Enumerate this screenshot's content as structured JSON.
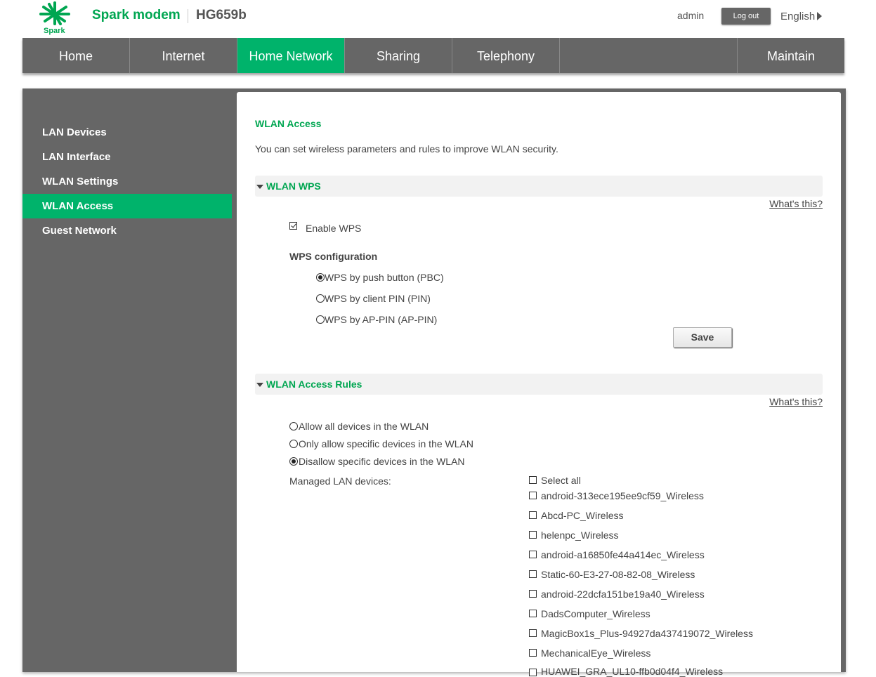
{
  "header": {
    "logo_text": "Spark",
    "brand": "Spark modem",
    "model": "HG659b",
    "user": "admin",
    "logout": "Log out",
    "language": "English"
  },
  "nav": [
    "Home",
    "Internet",
    "Home Network",
    "Sharing",
    "Telephony",
    "",
    "Maintain"
  ],
  "sidebar": [
    "LAN Devices",
    "LAN Interface",
    "WLAN Settings",
    "WLAN Access",
    "Guest Network"
  ],
  "content": {
    "title": "WLAN Access",
    "description": "You can set wireless parameters and rules to improve WLAN security.",
    "wps": {
      "section": "WLAN WPS",
      "whats_this": "What's this?",
      "enable_label": "Enable WPS",
      "enabled": true,
      "config_label": "WPS configuration",
      "options": [
        "WPS by push button (PBC)",
        "WPS by client PIN (PIN)",
        "WPS by AP-PIN (AP-PIN)"
      ],
      "selected": 0,
      "save": "Save"
    },
    "rules": {
      "section": "WLAN Access Rules",
      "whats_this": "What's this?",
      "options": [
        "Allow all devices in the WLAN",
        "Only allow specific devices in the WLAN",
        "Disallow specific devices in the WLAN"
      ],
      "selected": 2,
      "managed_label": "Managed LAN devices:",
      "select_all": "Select all",
      "devices": [
        "android-313ece195ee9cf59_Wireless",
        "Abcd-PC_Wireless",
        "helenpc_Wireless",
        "android-a16850fe44a414ec_Wireless",
        "Static-60-E3-27-08-82-08_Wireless",
        "android-22dcfa151be19a40_Wireless",
        "DadsComputer_Wireless",
        "MagicBox1s_Plus-94927da437419072_Wireless",
        "MechanicalEye_Wireless",
        "HUAWEI_GRA_UL10-ffb0d04f4_Wireless"
      ]
    }
  },
  "colors": {
    "accent": "#00a651",
    "active_bg": "#00b36b",
    "chrome": "#666666"
  }
}
